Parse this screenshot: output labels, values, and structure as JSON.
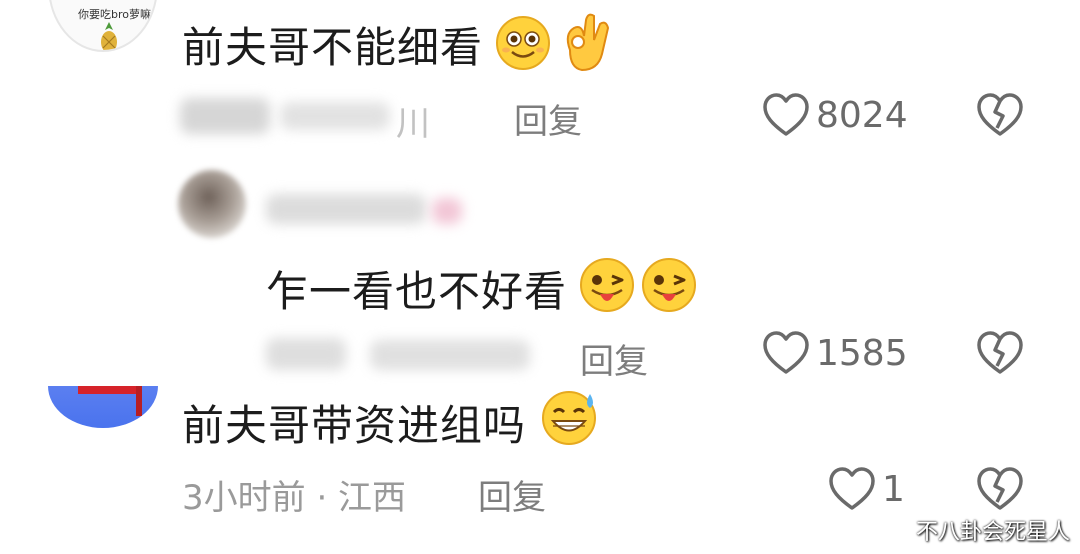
{
  "comments": [
    {
      "avatar_caption": "你要吃bro萝嘛",
      "text": "前夫哥不能细看",
      "emojis": [
        "smiling-face-icon",
        "ok-hand-icon"
      ],
      "meta_visible": "川",
      "reply_label": "回复",
      "like_count": "8024"
    },
    {
      "text": "乍一看也不好看",
      "emojis": [
        "tongue-wink-face-icon",
        "tongue-wink-face-icon"
      ],
      "reply_label": "回复",
      "like_count": "1585"
    },
    {
      "text": "前夫哥带资进组吗",
      "emojis": [
        "grinning-sweat-face-icon"
      ],
      "meta": "3小时前 · 江西",
      "reply_label": "回复",
      "like_count": "1"
    }
  ],
  "watermark": "不八卦会死星人",
  "colors": {
    "text": "#1c1c1c",
    "meta": "#9a9a9a",
    "icon": "#6a6a6a",
    "avatar_blue": "#4a73ee"
  }
}
